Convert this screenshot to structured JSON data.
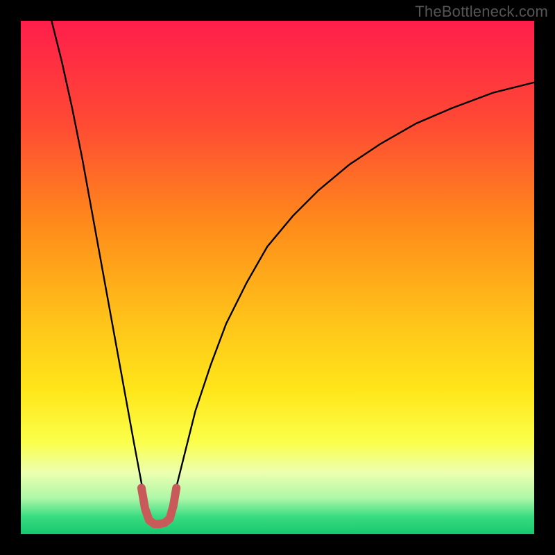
{
  "watermark": "TheBottleneck.com",
  "chart_data": {
    "type": "line",
    "title": "",
    "xlabel": "",
    "ylabel": "",
    "xlim": [
      0,
      100
    ],
    "ylim": [
      0,
      100
    ],
    "grid": false,
    "legend": false,
    "background_gradient_stops": [
      {
        "offset": 0.0,
        "color": "#ff1e4b"
      },
      {
        "offset": 0.2,
        "color": "#ff4a34"
      },
      {
        "offset": 0.4,
        "color": "#ff8c1a"
      },
      {
        "offset": 0.58,
        "color": "#ffc21a"
      },
      {
        "offset": 0.72,
        "color": "#ffe61a"
      },
      {
        "offset": 0.82,
        "color": "#fbff4a"
      },
      {
        "offset": 0.88,
        "color": "#ecffb0"
      },
      {
        "offset": 0.93,
        "color": "#aef7a8"
      },
      {
        "offset": 0.965,
        "color": "#3bdc82"
      },
      {
        "offset": 1.0,
        "color": "#16c86e"
      }
    ],
    "series": [
      {
        "name": "curve-left",
        "stroke": "#000000",
        "stroke_width": 2.4,
        "x": [
          6,
          8,
          10,
          12,
          14,
          16,
          18,
          20,
          22,
          23.5,
          24.8
        ],
        "y": [
          100,
          92,
          83,
          73,
          62,
          51,
          40,
          29,
          18,
          10,
          4
        ]
      },
      {
        "name": "curve-right",
        "stroke": "#000000",
        "stroke_width": 2.4,
        "x": [
          29.2,
          30,
          32,
          34,
          37,
          40,
          44,
          48,
          53,
          58,
          64,
          70,
          77,
          84,
          92,
          100
        ],
        "y": [
          4,
          8,
          16,
          24,
          33,
          41,
          49,
          56,
          62,
          67,
          72,
          76,
          80,
          83,
          86,
          88
        ]
      },
      {
        "name": "trough-highlight",
        "stroke": "#c85a5a",
        "stroke_width": 12,
        "linecap": "round",
        "x": [
          23.5,
          24.2,
          25.0,
          26.0,
          27.0,
          28.0,
          29.0,
          29.7,
          30.3
        ],
        "y": [
          9.0,
          5.0,
          2.7,
          2.0,
          2.0,
          2.2,
          3.0,
          5.5,
          9.0
        ]
      }
    ]
  }
}
